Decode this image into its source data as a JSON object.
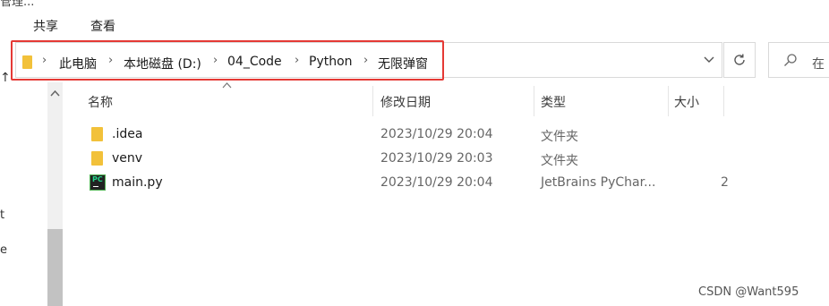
{
  "ribbon": {
    "cut_label": "管理...",
    "menu": [
      {
        "label": "共享"
      },
      {
        "label": "查看"
      }
    ]
  },
  "address": {
    "crumbs": [
      {
        "label": "此电脑"
      },
      {
        "label": "本地磁盘 (D:)"
      },
      {
        "label": "04_Code"
      },
      {
        "label": "Python"
      },
      {
        "label": "无限弹窗"
      }
    ],
    "dropdown_icon": "chevron-down-icon",
    "refresh_icon": "refresh-icon",
    "separator": "›"
  },
  "search": {
    "placeholder": "在"
  },
  "nav": {
    "up_arrow": "↑",
    "cut_items": [
      {
        "label": "t"
      },
      {
        "label": "e"
      }
    ]
  },
  "columns": [
    {
      "label": "名称"
    },
    {
      "label": "修改日期"
    },
    {
      "label": "类型"
    },
    {
      "label": "大小"
    }
  ],
  "files": [
    {
      "name": ".idea",
      "modified": "2023/10/29 20:04",
      "type": "文件夹",
      "size": "",
      "icon": "folder-icon"
    },
    {
      "name": "venv",
      "modified": "2023/10/29 20:03",
      "type": "文件夹",
      "size": "",
      "icon": "folder-icon"
    },
    {
      "name": "main.py",
      "modified": "2023/10/29 20:04",
      "type": "JetBrains PyChar...",
      "size": "2",
      "icon": "pycharm-file-icon"
    }
  ],
  "watermark": "CSDN @Want595"
}
